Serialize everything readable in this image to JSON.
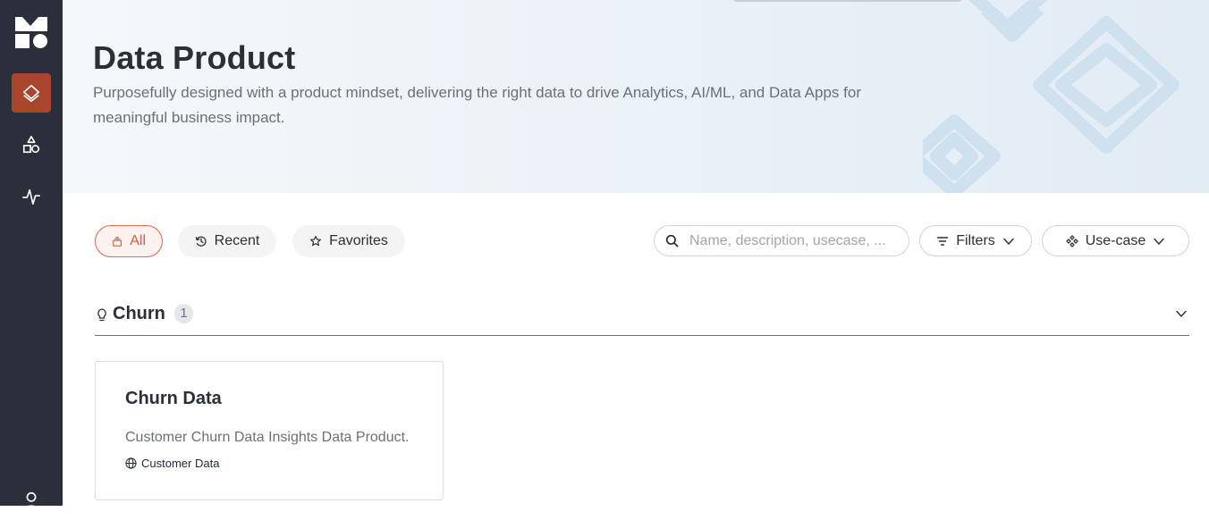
{
  "sidebar": {
    "logo": "dataos-logo",
    "items": [
      {
        "icon": "layers-icon",
        "active": true
      },
      {
        "icon": "shapes-icon",
        "active": false
      },
      {
        "icon": "activity-icon",
        "active": false
      }
    ],
    "user_icon": "user-icon",
    "active_color": "#a8452c"
  },
  "hero": {
    "title": "Data Product",
    "subtitle": "Purposefully designed with a product mindset, delivering the right data to drive Analytics, AI/ML, and Data Apps for meaningful business impact."
  },
  "toolbar": {
    "tabs": [
      {
        "label": "All",
        "icon": "stack-icon",
        "active": true
      },
      {
        "label": "Recent",
        "icon": "history-icon",
        "active": false
      },
      {
        "label": "Favorites",
        "icon": "star-icon",
        "active": false
      }
    ],
    "search": {
      "placeholder": "Name, description, usecase, ...",
      "value": ""
    },
    "filters_label": "Filters",
    "usecase_label": "Use-case",
    "accent_color": "#e05a38"
  },
  "section": {
    "title": "Churn",
    "count": "1",
    "icon": "lightbulb-icon"
  },
  "cards": [
    {
      "title": "Churn Data",
      "description": "Customer Churn Data Insights Data Product.",
      "tag": "Customer Data",
      "tag_icon": "globe-icon"
    }
  ]
}
